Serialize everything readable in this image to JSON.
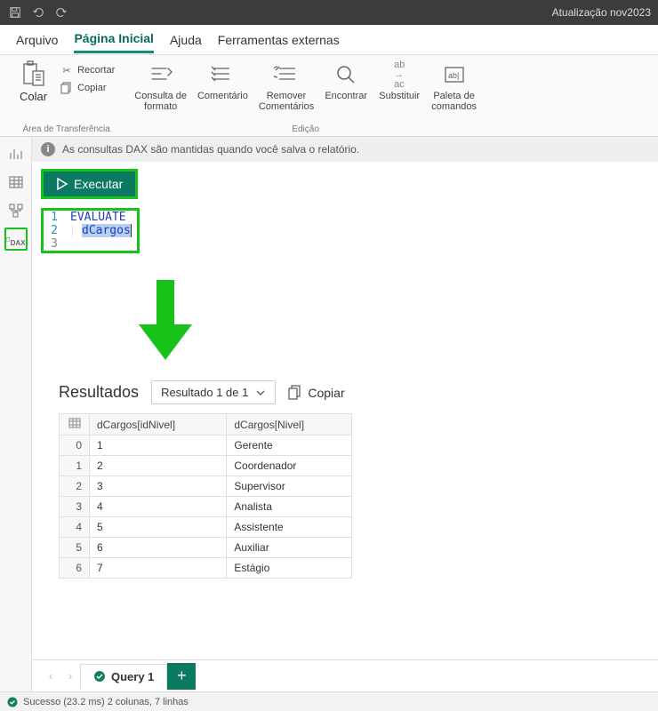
{
  "titlebar": {
    "title": "Atualização nov2023"
  },
  "menu": {
    "arquivo": "Arquivo",
    "inicio": "Página Inicial",
    "ajuda": "Ajuda",
    "ferramentas": "Ferramentas externas"
  },
  "ribbon": {
    "colar": "Colar",
    "recortar": "Recortar",
    "copiar": "Copiar",
    "group_clip": "Área de Transferência",
    "consulta": "Consulta de\nformato",
    "comentario": "Comentário",
    "remover": "Remover\nComentários",
    "encontrar": "Encontrar",
    "substituir": "Substituir",
    "paleta": "Paleta de\ncomandos",
    "group_edit": "Edição"
  },
  "sidebar": {
    "dax": "DAX"
  },
  "infobar": {
    "text": "As consultas DAX são mantidas quando você salva o relatório."
  },
  "run": {
    "label": "Executar"
  },
  "editor": {
    "lines": [
      {
        "n": "1",
        "text": "EVALUATE",
        "kind": "kw"
      },
      {
        "n": "2",
        "text": "dCargos",
        "kind": "ident"
      },
      {
        "n": "3",
        "text": "",
        "kind": ""
      }
    ]
  },
  "results": {
    "title": "Resultados",
    "selector": "Resultado 1 de 1",
    "copy": "Copiar",
    "columns": [
      "dCargos[idNivel]",
      "dCargos[Nivel]"
    ],
    "rows": [
      [
        "0",
        "1",
        "Gerente"
      ],
      [
        "1",
        "2",
        "Coordenador"
      ],
      [
        "2",
        "3",
        "Supervisor"
      ],
      [
        "3",
        "4",
        "Analista"
      ],
      [
        "4",
        "5",
        "Assistente"
      ],
      [
        "5",
        "6",
        "Auxiliar"
      ],
      [
        "6",
        "7",
        "Estágio"
      ]
    ]
  },
  "tabs": {
    "query1": "Query 1"
  },
  "status": {
    "text": "Sucesso (23.2 ms) 2 colunas, 7 linhas"
  }
}
